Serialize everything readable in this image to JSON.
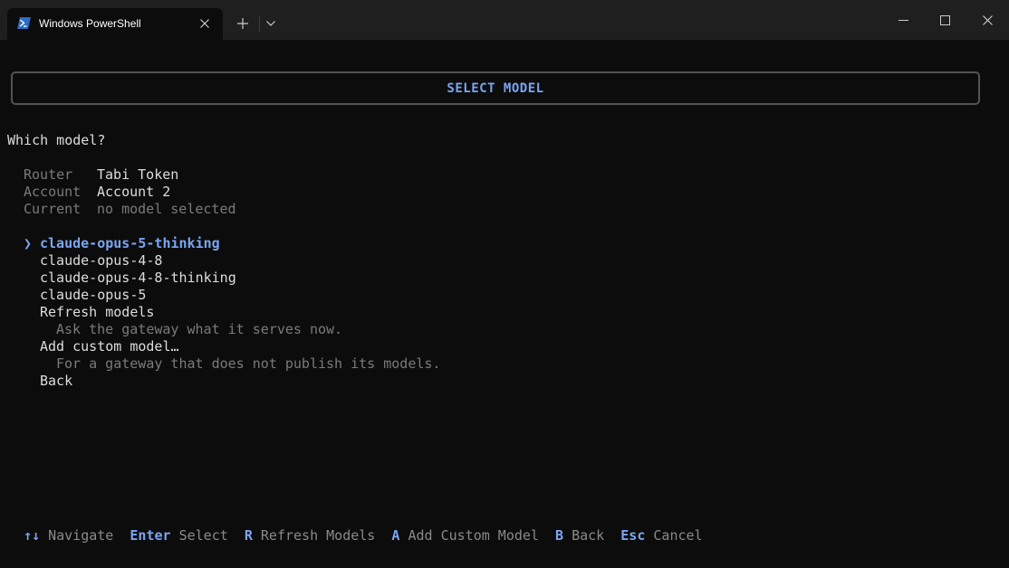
{
  "window": {
    "tab_title": "Windows PowerShell"
  },
  "header": {
    "title": "SELECT MODEL"
  },
  "prompt": "Which model?",
  "info": {
    "router_label": "Router",
    "router_value": "Tabi Token",
    "account_label": "Account",
    "account_value": "Account 2",
    "current_label": "Current",
    "current_value": "no model selected"
  },
  "menu": {
    "pointer": "❯",
    "items": [
      {
        "label": "claude-opus-5-thinking"
      },
      {
        "label": "claude-opus-4-8"
      },
      {
        "label": "claude-opus-4-8-thinking"
      },
      {
        "label": "claude-opus-5"
      },
      {
        "label": "Refresh models",
        "description": "Ask the gateway what it serves now."
      },
      {
        "label": "Add custom model…",
        "description": "For a gateway that does not publish its models."
      },
      {
        "label": "Back"
      }
    ]
  },
  "footer": {
    "navigate_key": "↑↓",
    "navigate_label": "Navigate",
    "select_key": "Enter",
    "select_label": "Select",
    "refresh_key": "R",
    "refresh_label": "Refresh Models",
    "add_key": "A",
    "add_label": "Add Custom Model",
    "back_key": "B",
    "back_label": "Back",
    "cancel_key": "Esc",
    "cancel_label": "Cancel"
  },
  "colors": {
    "accent": "#7aa5f2",
    "background": "#0c0c0c",
    "titlebar": "#1f1f1f",
    "dim_text": "#7a7a7a"
  }
}
